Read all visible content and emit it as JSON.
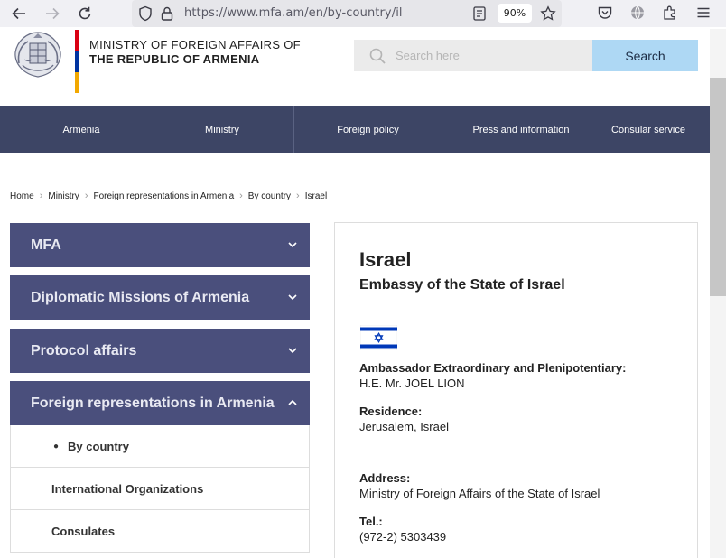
{
  "browser": {
    "url": "https://www.mfa.am/en/by-country/il",
    "zoom": "90%"
  },
  "header": {
    "title_line1": "MINISTRY OF FOREIGN AFFAIRS OF",
    "title_line2": "THE REPUBLIC OF ARMENIA",
    "search_placeholder": "Search here",
    "search_button": "Search",
    "flag_colors": [
      "#d90012",
      "#0033a0",
      "#f2a800"
    ]
  },
  "nav": {
    "items": [
      "Armenia",
      "Ministry",
      "Foreign policy",
      "Press and information",
      "Consular service"
    ]
  },
  "breadcrumb": {
    "links": [
      "Home",
      "Ministry",
      "Foreign representations in Armenia",
      "By country"
    ],
    "current": "Israel"
  },
  "sidebar": {
    "sections": [
      {
        "label": "MFA",
        "expanded": false
      },
      {
        "label": "Diplomatic Missions of Armenia",
        "expanded": false
      },
      {
        "label": "Protocol affairs",
        "expanded": false
      },
      {
        "label": "Foreign representations in Armenia",
        "expanded": true
      }
    ],
    "subitems": [
      {
        "label": "By country",
        "active": true
      },
      {
        "label": "International Organizations",
        "active": false
      },
      {
        "label": "Consulates",
        "active": false
      }
    ]
  },
  "content": {
    "country": "Israel",
    "embassy": "Embassy of the State of Israel",
    "fields": [
      {
        "label": "Ambassador Extraordinary and Plenipotentiary:",
        "value": "H.E. Mr. JOEL LION"
      },
      {
        "label": "Residence:",
        "value": "Jerusalem, Israel"
      },
      {
        "label": "Address:",
        "value": "Ministry of Foreign Affairs of the State of Israel"
      },
      {
        "label": "Tel.:",
        "value": "(972-2) 5303439"
      }
    ]
  },
  "colors": {
    "nav_bg": "#3d4565",
    "accordion_bg": "#4a4f7c",
    "search_button_bg": "#aed8f4"
  }
}
